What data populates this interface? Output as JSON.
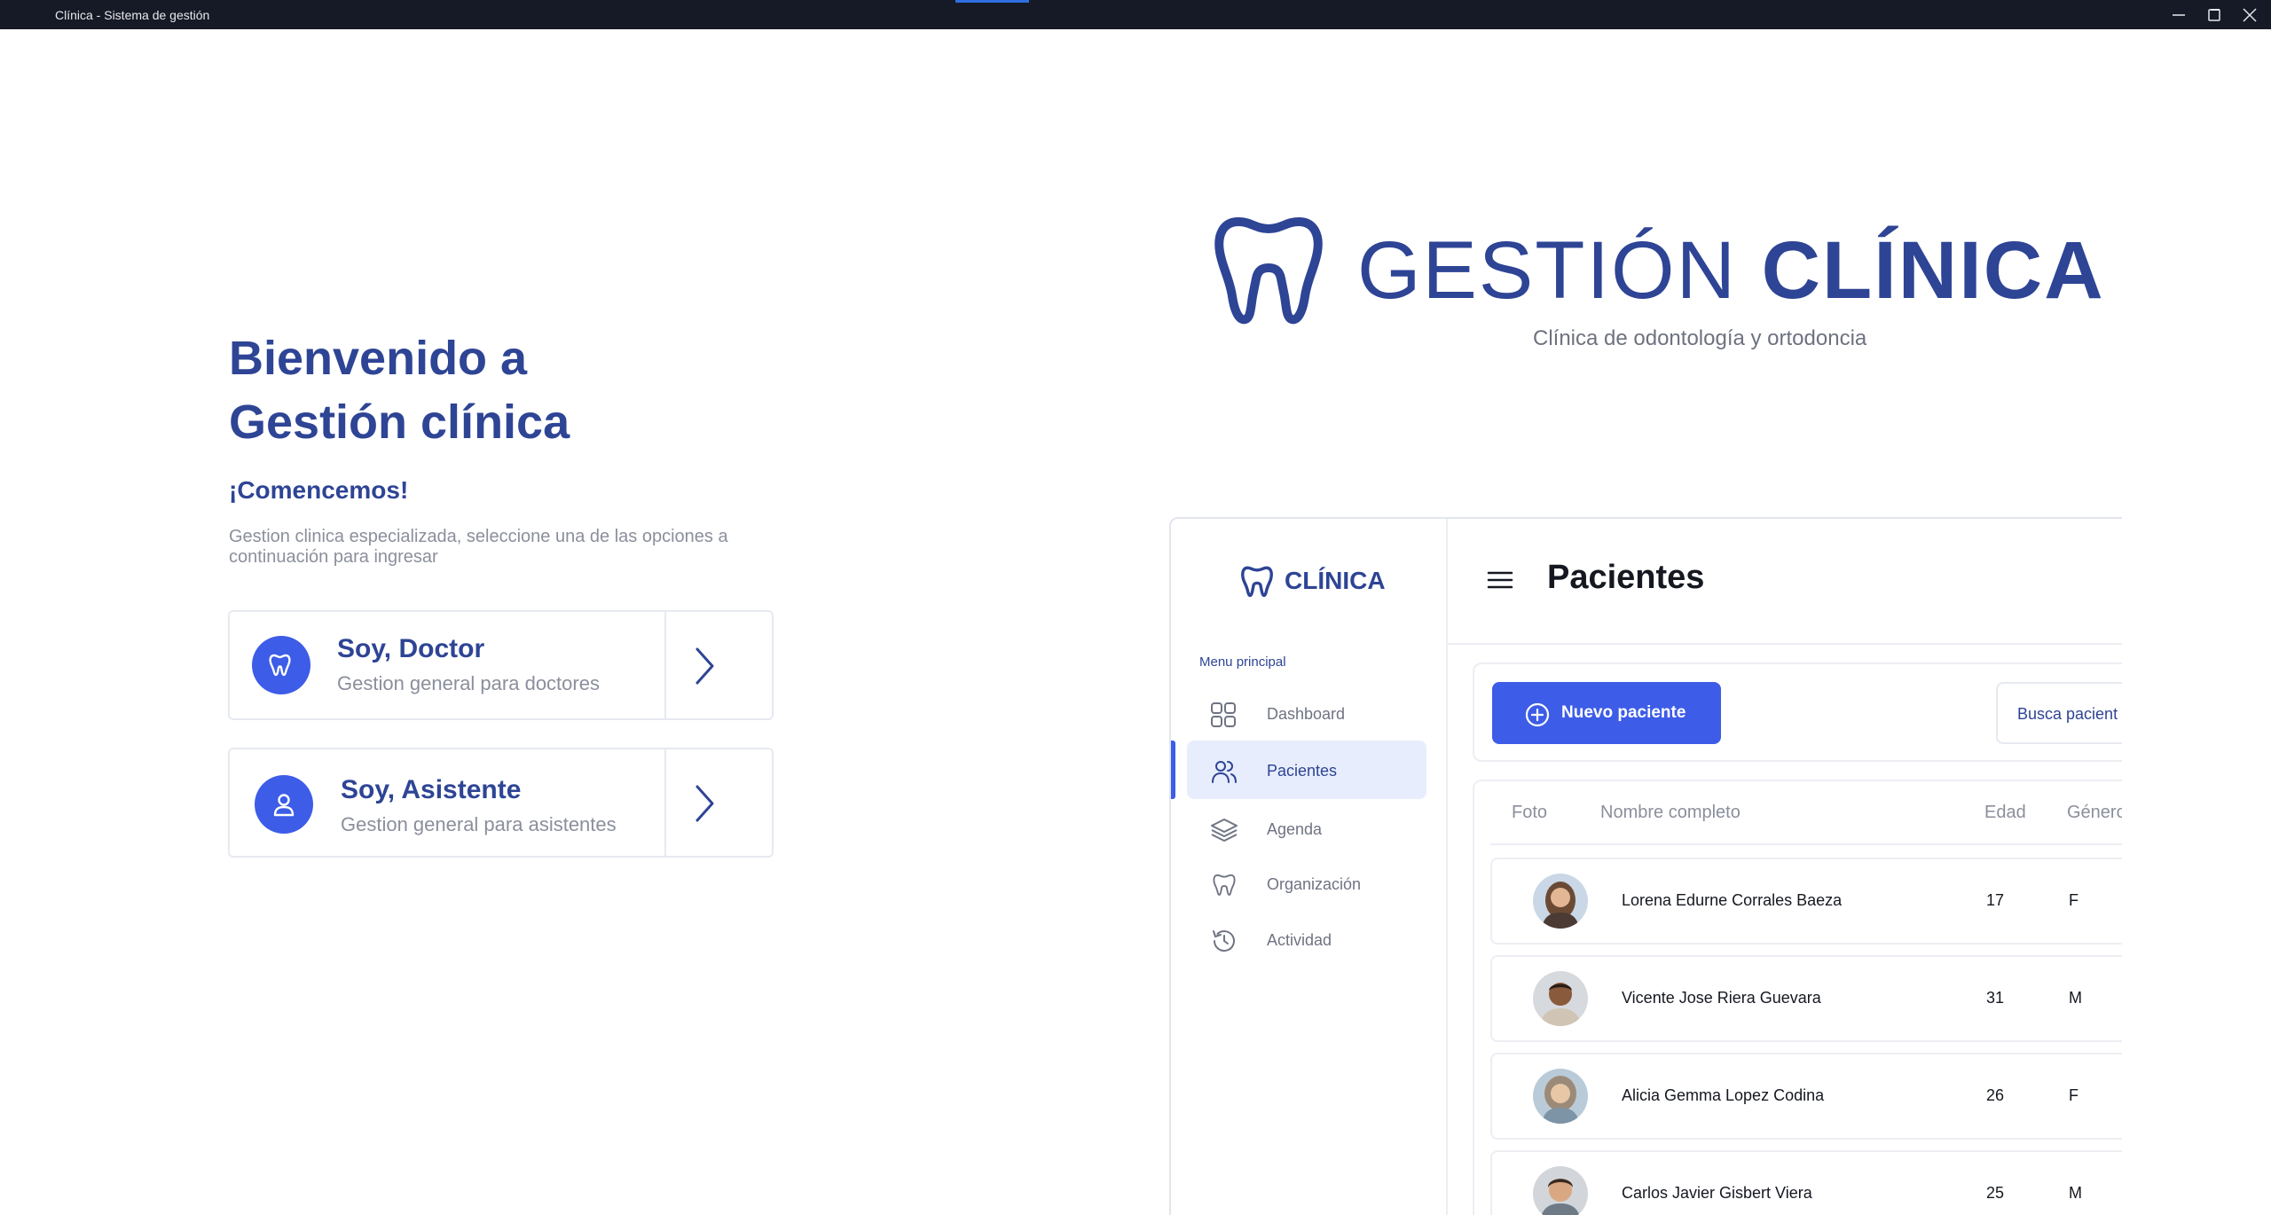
{
  "window": {
    "title": "Clínica - Sistema de gestión",
    "controls": [
      "minimize-icon",
      "maximize-icon",
      "close-icon"
    ]
  },
  "colors": {
    "brand": "#2e4495",
    "accent": "#3d5ce8",
    "muted_text": "#8b8f9c",
    "active_bg": "#e7edfc",
    "titlebar_bg": "#161a26",
    "titlebar_accent": "#2f6fe0"
  },
  "welcome": {
    "heading_line1": "Bienvenido a",
    "heading_line2": "Gestión clínica",
    "subheading": "¡Comencemos!",
    "description": "Gestion clinica especializada, seleccione una de las opciones a continuación para ingresar"
  },
  "roles": [
    {
      "title": "Soy, Doctor",
      "subtitle": "Gestion general para doctores",
      "icon": "tooth-icon"
    },
    {
      "title": "Soy, Asistente",
      "subtitle": "Gestion general para asistentes",
      "icon": "user-icon"
    }
  ],
  "logo": {
    "word_light": "GESTIÓN",
    "word_bold": "CLÍNICA",
    "tagline": "Clínica de odontología y ortodoncia"
  },
  "preview": {
    "brand": "CLÍNICA",
    "menu_label": "Menu principal",
    "menu": [
      {
        "label": "Dashboard",
        "icon": "grid-icon",
        "active": false
      },
      {
        "label": "Pacientes",
        "icon": "users-icon",
        "active": true
      },
      {
        "label": "Agenda",
        "icon": "layers-icon",
        "active": false
      },
      {
        "label": "Organización",
        "icon": "tooth-icon",
        "active": false
      },
      {
        "label": "Actividad",
        "icon": "history-icon",
        "active": false
      }
    ],
    "page_title": "Pacientes",
    "new_button": "Nuevo paciente",
    "search_placeholder": "Busca pacient",
    "columns": [
      "Foto",
      "Nombre completo",
      "Edad",
      "Génerc"
    ],
    "patients": [
      {
        "name": "Lorena Edurne Corrales Baeza",
        "age": "17",
        "gender": "F"
      },
      {
        "name": "Vicente Jose Riera Guevara",
        "age": "31",
        "gender": "M"
      },
      {
        "name": "Alicia Gemma Lopez Codina",
        "age": "26",
        "gender": "F"
      },
      {
        "name": "Carlos Javier Gisbert Viera",
        "age": "25",
        "gender": "M"
      }
    ]
  }
}
